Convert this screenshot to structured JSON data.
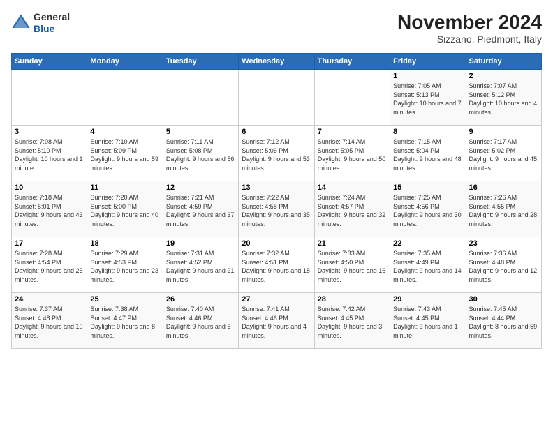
{
  "header": {
    "logo_general": "General",
    "logo_blue": "Blue",
    "title": "November 2024",
    "subtitle": "Sizzano, Piedmont, Italy"
  },
  "calendar": {
    "weekdays": [
      "Sunday",
      "Monday",
      "Tuesday",
      "Wednesday",
      "Thursday",
      "Friday",
      "Saturday"
    ],
    "weeks": [
      [
        {
          "day": "",
          "info": ""
        },
        {
          "day": "",
          "info": ""
        },
        {
          "day": "",
          "info": ""
        },
        {
          "day": "",
          "info": ""
        },
        {
          "day": "",
          "info": ""
        },
        {
          "day": "1",
          "info": "Sunrise: 7:05 AM\nSunset: 5:13 PM\nDaylight: 10 hours and 7 minutes."
        },
        {
          "day": "2",
          "info": "Sunrise: 7:07 AM\nSunset: 5:12 PM\nDaylight: 10 hours and 4 minutes."
        }
      ],
      [
        {
          "day": "3",
          "info": "Sunrise: 7:08 AM\nSunset: 5:10 PM\nDaylight: 10 hours and 1 minute."
        },
        {
          "day": "4",
          "info": "Sunrise: 7:10 AM\nSunset: 5:09 PM\nDaylight: 9 hours and 59 minutes."
        },
        {
          "day": "5",
          "info": "Sunrise: 7:11 AM\nSunset: 5:08 PM\nDaylight: 9 hours and 56 minutes."
        },
        {
          "day": "6",
          "info": "Sunrise: 7:12 AM\nSunset: 5:06 PM\nDaylight: 9 hours and 53 minutes."
        },
        {
          "day": "7",
          "info": "Sunrise: 7:14 AM\nSunset: 5:05 PM\nDaylight: 9 hours and 50 minutes."
        },
        {
          "day": "8",
          "info": "Sunrise: 7:15 AM\nSunset: 5:04 PM\nDaylight: 9 hours and 48 minutes."
        },
        {
          "day": "9",
          "info": "Sunrise: 7:17 AM\nSunset: 5:02 PM\nDaylight: 9 hours and 45 minutes."
        }
      ],
      [
        {
          "day": "10",
          "info": "Sunrise: 7:18 AM\nSunset: 5:01 PM\nDaylight: 9 hours and 43 minutes."
        },
        {
          "day": "11",
          "info": "Sunrise: 7:20 AM\nSunset: 5:00 PM\nDaylight: 9 hours and 40 minutes."
        },
        {
          "day": "12",
          "info": "Sunrise: 7:21 AM\nSunset: 4:59 PM\nDaylight: 9 hours and 37 minutes."
        },
        {
          "day": "13",
          "info": "Sunrise: 7:22 AM\nSunset: 4:58 PM\nDaylight: 9 hours and 35 minutes."
        },
        {
          "day": "14",
          "info": "Sunrise: 7:24 AM\nSunset: 4:57 PM\nDaylight: 9 hours and 32 minutes."
        },
        {
          "day": "15",
          "info": "Sunrise: 7:25 AM\nSunset: 4:56 PM\nDaylight: 9 hours and 30 minutes."
        },
        {
          "day": "16",
          "info": "Sunrise: 7:26 AM\nSunset: 4:55 PM\nDaylight: 9 hours and 28 minutes."
        }
      ],
      [
        {
          "day": "17",
          "info": "Sunrise: 7:28 AM\nSunset: 4:54 PM\nDaylight: 9 hours and 25 minutes."
        },
        {
          "day": "18",
          "info": "Sunrise: 7:29 AM\nSunset: 4:53 PM\nDaylight: 9 hours and 23 minutes."
        },
        {
          "day": "19",
          "info": "Sunrise: 7:31 AM\nSunset: 4:52 PM\nDaylight: 9 hours and 21 minutes."
        },
        {
          "day": "20",
          "info": "Sunrise: 7:32 AM\nSunset: 4:51 PM\nDaylight: 9 hours and 18 minutes."
        },
        {
          "day": "21",
          "info": "Sunrise: 7:33 AM\nSunset: 4:50 PM\nDaylight: 9 hours and 16 minutes."
        },
        {
          "day": "22",
          "info": "Sunrise: 7:35 AM\nSunset: 4:49 PM\nDaylight: 9 hours and 14 minutes."
        },
        {
          "day": "23",
          "info": "Sunrise: 7:36 AM\nSunset: 4:48 PM\nDaylight: 9 hours and 12 minutes."
        }
      ],
      [
        {
          "day": "24",
          "info": "Sunrise: 7:37 AM\nSunset: 4:48 PM\nDaylight: 9 hours and 10 minutes."
        },
        {
          "day": "25",
          "info": "Sunrise: 7:38 AM\nSunset: 4:47 PM\nDaylight: 9 hours and 8 minutes."
        },
        {
          "day": "26",
          "info": "Sunrise: 7:40 AM\nSunset: 4:46 PM\nDaylight: 9 hours and 6 minutes."
        },
        {
          "day": "27",
          "info": "Sunrise: 7:41 AM\nSunset: 4:46 PM\nDaylight: 9 hours and 4 minutes."
        },
        {
          "day": "28",
          "info": "Sunrise: 7:42 AM\nSunset: 4:45 PM\nDaylight: 9 hours and 3 minutes."
        },
        {
          "day": "29",
          "info": "Sunrise: 7:43 AM\nSunset: 4:45 PM\nDaylight: 9 hours and 1 minute."
        },
        {
          "day": "30",
          "info": "Sunrise: 7:45 AM\nSunset: 4:44 PM\nDaylight: 8 hours and 59 minutes."
        }
      ]
    ]
  }
}
